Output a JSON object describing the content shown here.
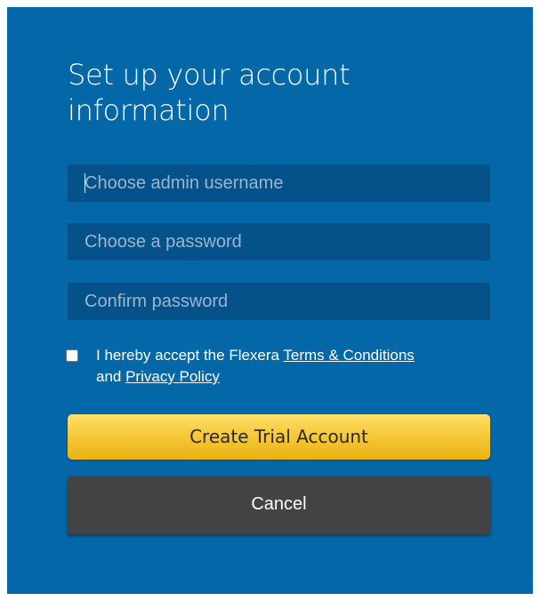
{
  "form": {
    "title": "Set up your account information",
    "username_placeholder": "Choose admin username",
    "password_placeholder": "Choose a password",
    "confirm_placeholder": "Confirm password",
    "terms": {
      "text_before": "I hereby accept the Flexera ",
      "terms_link": "Terms & Conditions",
      "text_middle": " and ",
      "privacy_link": "Privacy Policy",
      "checked": false
    },
    "create_button": "Create Trial Account",
    "cancel_button": "Cancel"
  },
  "colors": {
    "panel_bg": "#0467a8",
    "field_bg": "#05528a",
    "primary_button": "#f6c93a",
    "secondary_button": "#434346"
  }
}
